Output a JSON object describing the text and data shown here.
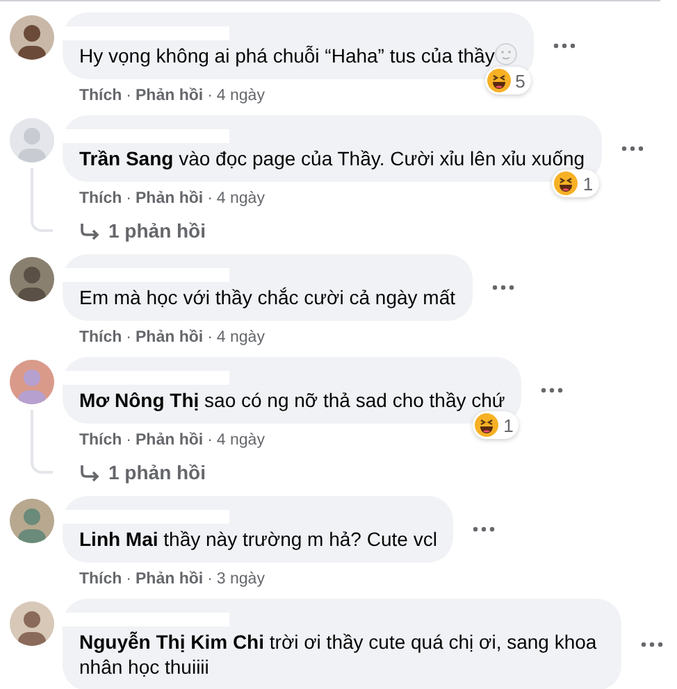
{
  "comments": [
    {
      "text": "Hy vọng không ai phá chuỗi “Haha” tus của thầy",
      "emoji_suffix": true,
      "reaction_count": "5",
      "actions": [
        {
          "kind": "link",
          "text": "Thích"
        },
        {
          "kind": "sep",
          "text": "·"
        },
        {
          "kind": "link",
          "text": "Phản hồi"
        },
        {
          "kind": "sep",
          "text": "·"
        },
        {
          "kind": "time",
          "text": "4 ngày"
        }
      ]
    },
    {
      "text": "**Trần Sang** vào đọc page của Thầy. Cười xỉu lên xỉu xuống",
      "emoji_suffix": false,
      "reaction_count": "1",
      "actions": [
        {
          "kind": "link",
          "text": "Thích"
        },
        {
          "kind": "sep",
          "text": "·"
        },
        {
          "kind": "link",
          "text": "Phản hồi"
        },
        {
          "kind": "sep",
          "text": "·"
        },
        {
          "kind": "time",
          "text": "4 ngày"
        }
      ],
      "replies_link": "1 phản hồi"
    },
    {
      "text": "Em mà học với thầy chắc cười cả ngày mất",
      "emoji_suffix": false,
      "actions": [
        {
          "kind": "link",
          "text": "Thích"
        },
        {
          "kind": "sep",
          "text": "·"
        },
        {
          "kind": "link",
          "text": "Phản hồi"
        },
        {
          "kind": "sep",
          "text": "·"
        },
        {
          "kind": "time",
          "text": "4 ngày"
        }
      ]
    },
    {
      "text": "**Mơ Nông Thị** sao có ng nỡ thả sad cho thầy chứ",
      "emoji_suffix": false,
      "reaction_count": "1",
      "actions": [
        {
          "kind": "link",
          "text": "Thích"
        },
        {
          "kind": "sep",
          "text": "·"
        },
        {
          "kind": "link",
          "text": "Phản hồi"
        },
        {
          "kind": "sep",
          "text": "·"
        },
        {
          "kind": "time",
          "text": "4 ngày"
        }
      ],
      "replies_link": "1 phản hồi"
    },
    {
      "text": "**Linh Mai** thầy này trường m hả? Cute vcl",
      "emoji_suffix": false,
      "actions": [
        {
          "kind": "link",
          "text": "Thích"
        },
        {
          "kind": "sep",
          "text": "·"
        },
        {
          "kind": "link",
          "text": "Phản hồi"
        },
        {
          "kind": "sep",
          "text": "·"
        },
        {
          "kind": "time",
          "text": "3 ngày"
        }
      ]
    },
    {
      "text": "**Nguyễn Thị Kim Chi** trời ơi thầy cute quá chị ơi, sang khoa nhân học thuiiii",
      "emoji_suffix": false
    }
  ]
}
